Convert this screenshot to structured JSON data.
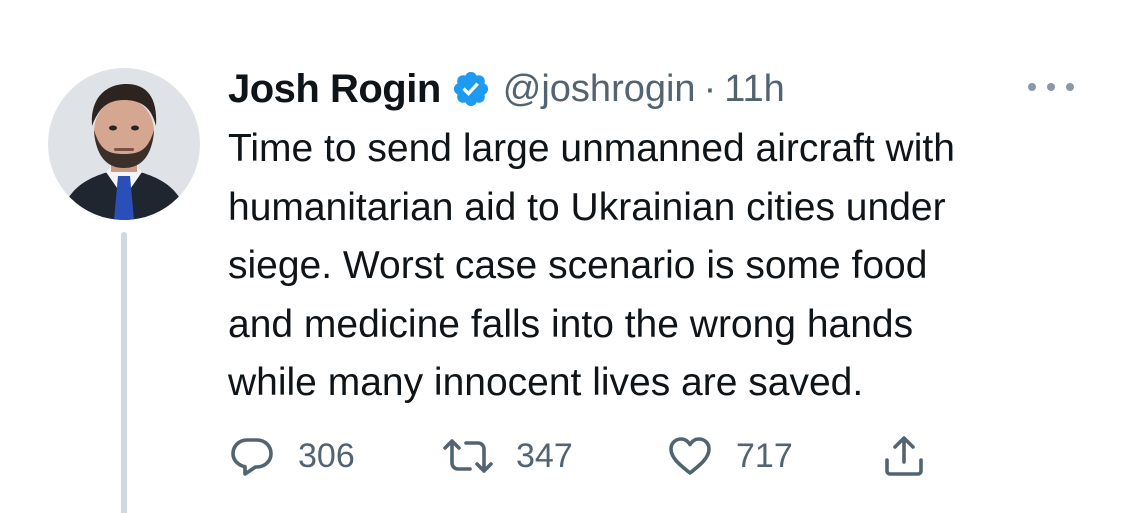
{
  "author": {
    "name": "Josh Rogin",
    "handle": "@joshrogin",
    "separator": "·",
    "time": "11h",
    "verified": true
  },
  "tweet": {
    "text": "Time to send large unmanned aircraft with\nhumanitarian aid to Ukrainian cities under\nsiege. Worst case scenario is some food\nand medicine falls into the wrong hands\nwhile many innocent lives are saved."
  },
  "actions": {
    "replies": "306",
    "retweets": "347",
    "likes": "717"
  },
  "icons": {
    "verified": "verified-badge-icon",
    "more": "more-icon",
    "reply": "reply-icon",
    "retweet": "retweet-icon",
    "like": "heart-icon",
    "share": "share-icon"
  },
  "colors": {
    "verified": "#1d9bf0",
    "muted": "#536471",
    "text": "#0f1419",
    "thread_line": "#cfd9de"
  }
}
